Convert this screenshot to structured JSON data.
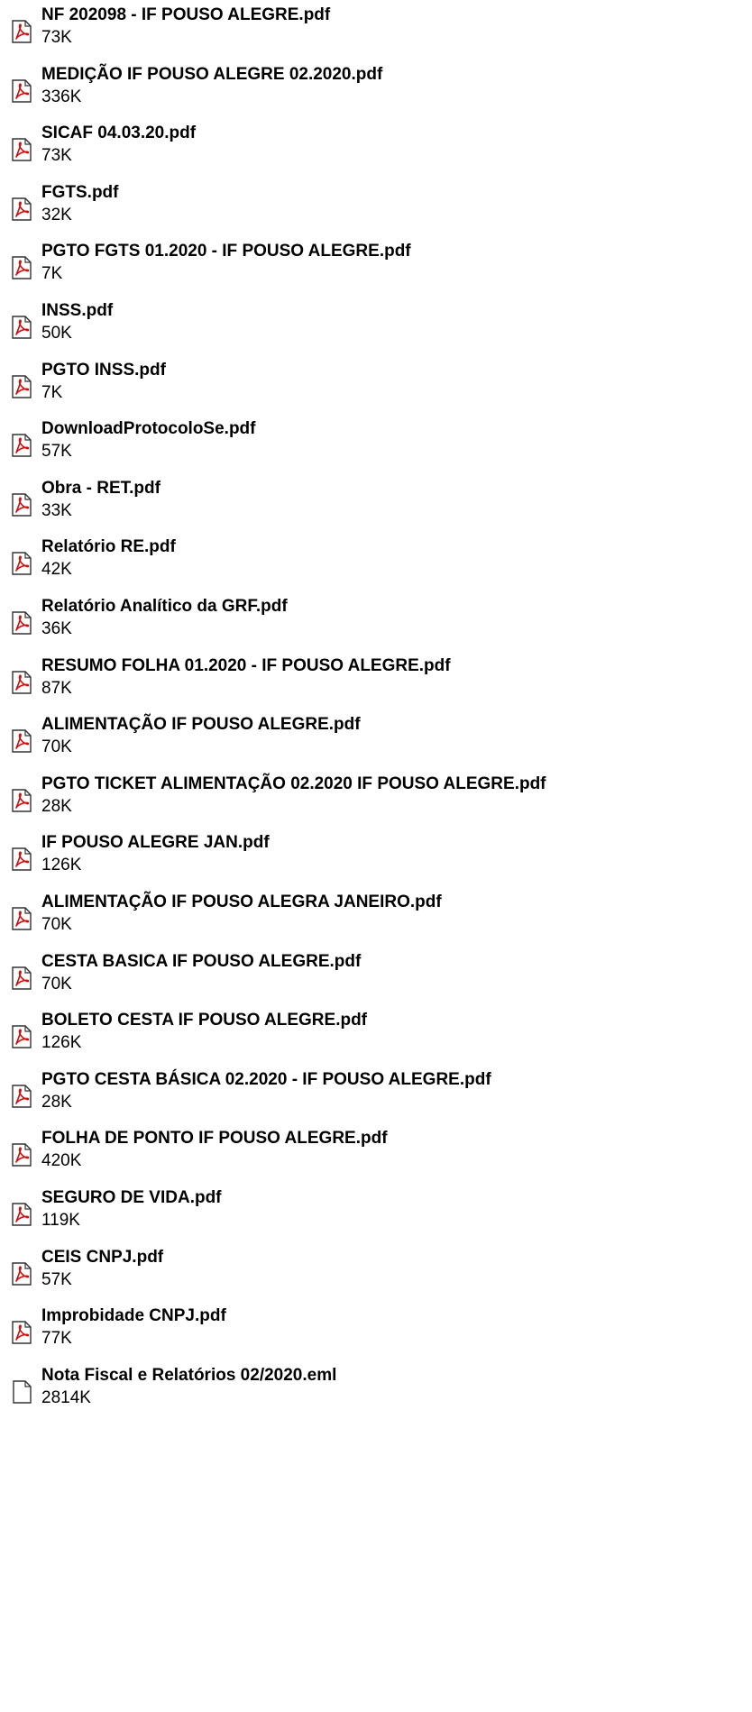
{
  "attachments": [
    {
      "name": "NF 202098 - IF POUSO ALEGRE.pdf",
      "size": "73K",
      "icon": "pdf-icon"
    },
    {
      "name": "MEDIÇÃO IF POUSO ALEGRE 02.2020.pdf",
      "size": "336K",
      "icon": "pdf-icon"
    },
    {
      "name": "SICAF 04.03.20.pdf",
      "size": "73K",
      "icon": "pdf-icon"
    },
    {
      "name": "FGTS.pdf",
      "size": "32K",
      "icon": "pdf-icon"
    },
    {
      "name": "PGTO FGTS 01.2020 - IF POUSO ALEGRE.pdf",
      "size": "7K",
      "icon": "pdf-icon"
    },
    {
      "name": "INSS.pdf",
      "size": "50K",
      "icon": "pdf-icon"
    },
    {
      "name": "PGTO INSS.pdf",
      "size": "7K",
      "icon": "pdf-icon"
    },
    {
      "name": "DownloadProtocoloSe.pdf",
      "size": "57K",
      "icon": "pdf-icon"
    },
    {
      "name": "Obra - RET.pdf",
      "size": "33K",
      "icon": "pdf-icon"
    },
    {
      "name": "Relatório RE.pdf",
      "size": "42K",
      "icon": "pdf-icon"
    },
    {
      "name": "Relatório Analítico da GRF.pdf",
      "size": "36K",
      "icon": "pdf-icon"
    },
    {
      "name": "RESUMO FOLHA 01.2020 - IF POUSO ALEGRE.pdf",
      "size": "87K",
      "icon": "pdf-icon"
    },
    {
      "name": "ALIMENTAÇÃO IF POUSO ALEGRE.pdf",
      "size": "70K",
      "icon": "pdf-icon"
    },
    {
      "name": "PGTO TICKET ALIMENTAÇÃO 02.2020  IF POUSO ALEGRE.pdf",
      "size": "28K",
      "icon": "pdf-icon"
    },
    {
      "name": "IF POUSO ALEGRE JAN.pdf",
      "size": "126K",
      "icon": "pdf-icon"
    },
    {
      "name": "ALIMENTAÇÃO IF POUSO ALEGRA JANEIRO.pdf",
      "size": "70K",
      "icon": "pdf-icon"
    },
    {
      "name": "CESTA BASICA IF POUSO ALEGRE.pdf",
      "size": "70K",
      "icon": "pdf-icon"
    },
    {
      "name": "BOLETO CESTA IF POUSO ALEGRE.pdf",
      "size": "126K",
      "icon": "pdf-icon"
    },
    {
      "name": "PGTO CESTA BÁSICA 02.2020 - IF POUSO ALEGRE.pdf",
      "size": "28K",
      "icon": "pdf-icon"
    },
    {
      "name": "FOLHA DE PONTO IF POUSO ALEGRE.pdf",
      "size": "420K",
      "icon": "pdf-icon"
    },
    {
      "name": "SEGURO DE VIDA.pdf",
      "size": "119K",
      "icon": "pdf-icon"
    },
    {
      "name": "CEIS CNPJ.pdf",
      "size": "57K",
      "icon": "pdf-icon"
    },
    {
      "name": "Improbidade CNPJ.pdf",
      "size": "77K",
      "icon": "pdf-icon"
    },
    {
      "name": "Nota Fiscal e Relatórios 02/2020.eml",
      "size": "2814K",
      "icon": "document-icon"
    }
  ],
  "colors": {
    "pdf_icon_red": "#cc1111",
    "text": "#000000",
    "background": "#ffffff"
  }
}
